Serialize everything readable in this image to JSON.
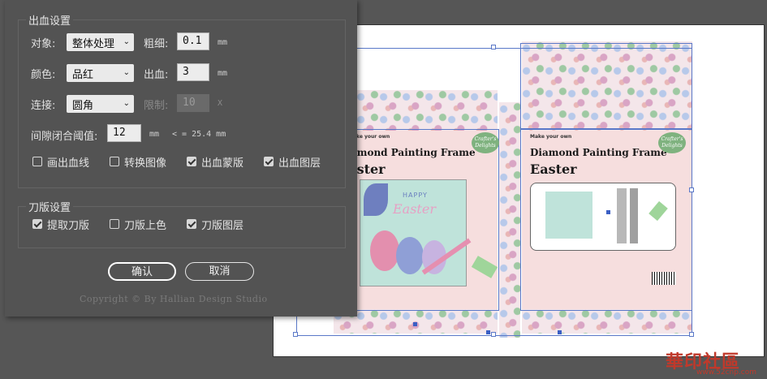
{
  "dialog": {
    "bleed_group_title": "出血设置",
    "object_label": "对象:",
    "object_value": "整体处理",
    "stroke_label": "粗细:",
    "stroke_value": "0.1",
    "stroke_unit": "mm",
    "color_label": "颜色:",
    "color_value": "品红",
    "bleed_label": "出血:",
    "bleed_value": "3",
    "bleed_unit": "mm",
    "join_label": "连接:",
    "join_value": "圆角",
    "limit_label": "限制:",
    "limit_value": "10",
    "limit_unit": "X",
    "gap_label": "间隙闭合阈值:",
    "gap_value": "12",
    "gap_unit": "mm",
    "gap_note": "< = 25.4 mm",
    "checkboxes": [
      {
        "label": "画出血线",
        "checked": false
      },
      {
        "label": "转换图像",
        "checked": false
      },
      {
        "label": "出血蒙版",
        "checked": true
      },
      {
        "label": "出血图层",
        "checked": true
      }
    ],
    "die_group_title": "刀版设置",
    "die_checkboxes": [
      {
        "label": "提取刀版",
        "checked": true
      },
      {
        "label": "刀版上色",
        "checked": false
      },
      {
        "label": "刀版图层",
        "checked": true
      }
    ],
    "ok_label": "确认",
    "cancel_label": "取消",
    "copyright": "Copyright © By Hallian Design Studio"
  },
  "artwork": {
    "left_make": "Make your own",
    "left_title": "Diamond Painting Frame",
    "left_sub": "Easter",
    "right_make": "Make your own",
    "right_title": "Diamond Painting Frame",
    "right_sub": "Easter",
    "badge_text": "Crafter's Delights",
    "card_happy": "HAPPY",
    "card_easter": "Easter"
  },
  "watermark": {
    "text": "華印社區",
    "url": "www.52cnp.com"
  },
  "colors": {
    "dialog_bg": "#535353",
    "canvas_bg": "#565656",
    "dieline": "#5a78c8"
  }
}
